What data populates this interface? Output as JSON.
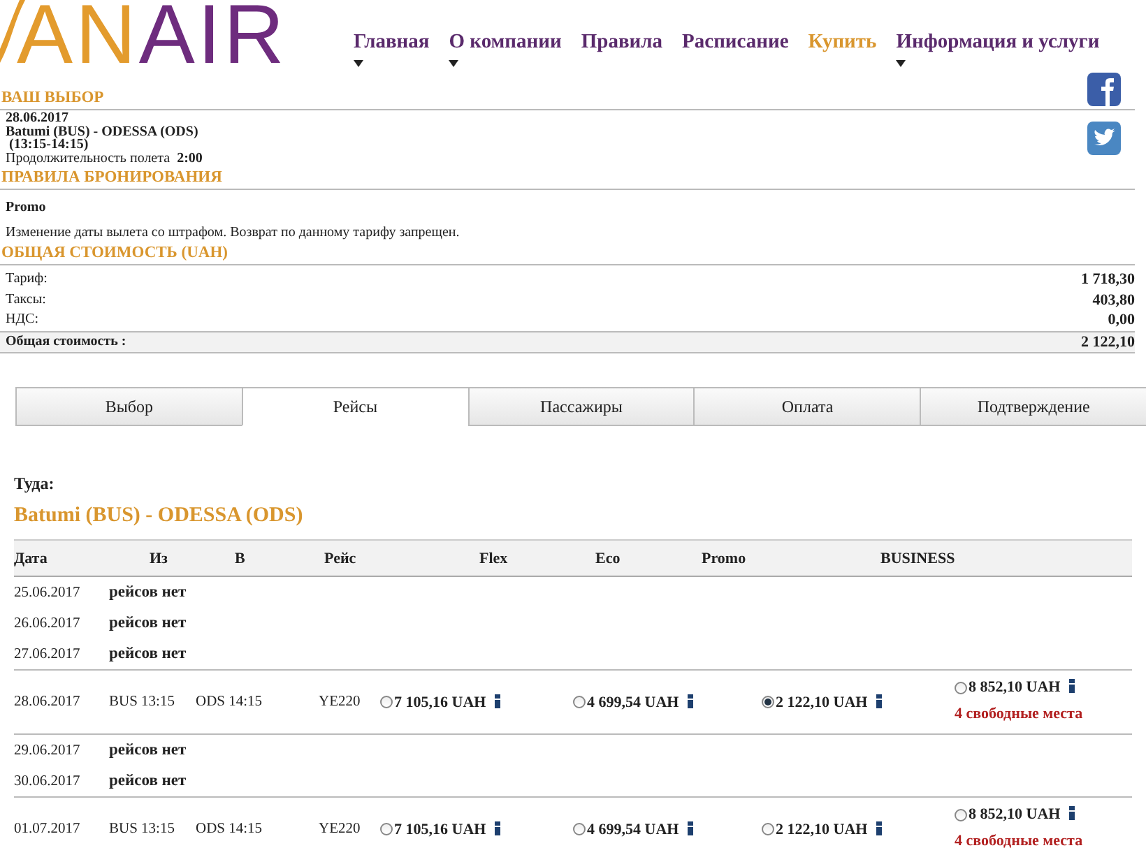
{
  "logo": {
    "parts": [
      {
        "text": "AN",
        "color": "#e39b2d"
      },
      {
        "text": "AIR",
        "color": "#6e2c7e"
      }
    ]
  },
  "nav": [
    {
      "label": "Главная",
      "dropdown": true,
      "selected": false
    },
    {
      "label": "О компании",
      "dropdown": true,
      "selected": false
    },
    {
      "label": "Правила",
      "dropdown": false,
      "selected": false
    },
    {
      "label": "Расписание",
      "dropdown": false,
      "selected": false
    },
    {
      "label": "Купить",
      "dropdown": false,
      "selected": true
    },
    {
      "label": "Информация и услуги",
      "dropdown": true,
      "selected": false
    }
  ],
  "choice": {
    "title": "ВАШ ВЫБОР",
    "date": "28.06.2017",
    "route": "Batumi (BUS) - ODESSA (ODS)",
    "time": "(13:15-14:15)",
    "duration_label": "Продолжительность полета",
    "duration": "2:00"
  },
  "rules": {
    "title": "ПРАВИЛА БРОНИРОВАНИЯ",
    "fare": "Promo",
    "text": "Изменение даты вылета со штрафом. Возврат по данному тарифу запрещен."
  },
  "total": {
    "title": "ОБЩАЯ СТОИМОСТЬ (UAH)",
    "rows": [
      {
        "label": "Тариф:",
        "value": "1 718,30"
      },
      {
        "label": "Таксы:",
        "value": "403,80"
      },
      {
        "label": "НДС:",
        "value": "0,00"
      }
    ],
    "sum": {
      "label": "Общая стоимость :",
      "value": "2 122,10"
    }
  },
  "tabs": [
    {
      "label": "Выбор",
      "selected": false
    },
    {
      "label": "Рейсы",
      "selected": true
    },
    {
      "label": "Пассажиры",
      "selected": false
    },
    {
      "label": "Оплата",
      "selected": false
    },
    {
      "label": "Подтверждение",
      "selected": false
    }
  ],
  "flights": {
    "direction": "Туда:",
    "route": "Batumi (BUS) - ODESSA (ODS)",
    "columns": [
      "Дата",
      "Из",
      "В",
      "Рейс",
      "Flex",
      "Eco",
      "Promo",
      "BUSINESS"
    ],
    "rows": [
      {
        "kind": "none",
        "date": "25.06.2017",
        "note": "рейсов нет"
      },
      {
        "kind": "none",
        "date": "26.06.2017",
        "note": "рейсов нет"
      },
      {
        "kind": "none",
        "date": "27.06.2017",
        "note": "рейсов нет"
      },
      {
        "kind": "flight",
        "date": "28.06.2017",
        "from": "BUS 13:15",
        "to": "ODS 14:15",
        "flight": "YE220",
        "fares": [
          {
            "price": "7 105,16 UAH",
            "selected": false
          },
          {
            "price": "4 699,54 UAH",
            "selected": false
          },
          {
            "price": "2 122,10 UAH",
            "selected": true
          },
          {
            "price": "8 852,10 UAH",
            "selected": false,
            "seats": "4 свободные места"
          }
        ]
      },
      {
        "kind": "none",
        "date": "29.06.2017",
        "note": "рейсов нет"
      },
      {
        "kind": "none",
        "date": "30.06.2017",
        "note": "рейсов нет"
      },
      {
        "kind": "flight",
        "date": "01.07.2017",
        "from": "BUS 13:15",
        "to": "ODS 14:15",
        "flight": "YE220",
        "fares": [
          {
            "price": "7 105,16 UAH",
            "selected": false
          },
          {
            "price": "4 699,54 UAH",
            "selected": false
          },
          {
            "price": "2 122,10 UAH",
            "selected": false
          },
          {
            "price": "8 852,10 UAH",
            "selected": false,
            "seats": "4 свободные места"
          }
        ]
      }
    ]
  }
}
